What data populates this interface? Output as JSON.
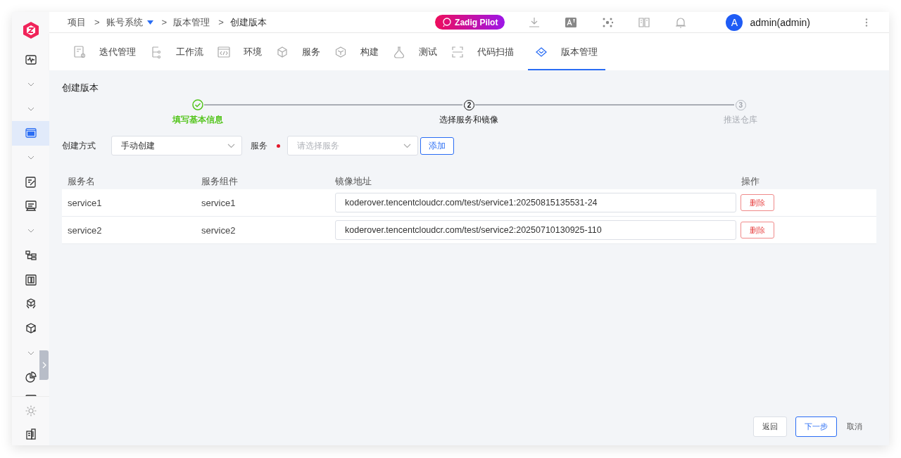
{
  "sidebar": {
    "items": [
      {
        "kind": "icon",
        "selected": false
      },
      {
        "kind": "chevron",
        "selected": false
      },
      {
        "kind": "chevron",
        "selected": false
      },
      {
        "kind": "icon",
        "selected": true
      },
      {
        "kind": "chevron",
        "selected": false
      },
      {
        "kind": "icon",
        "selected": false
      },
      {
        "kind": "icon",
        "selected": false
      },
      {
        "kind": "chevron",
        "selected": false
      },
      {
        "kind": "icon",
        "selected": false
      },
      {
        "kind": "icon",
        "selected": false
      },
      {
        "kind": "icon",
        "selected": false
      },
      {
        "kind": "icon",
        "selected": false
      },
      {
        "kind": "chevron",
        "selected": false
      },
      {
        "kind": "icon",
        "selected": false
      },
      {
        "kind": "icon",
        "selected": false
      }
    ],
    "bottom_items": [
      {
        "kind": "icon",
        "selected": false
      },
      {
        "kind": "icon",
        "selected": false
      }
    ]
  },
  "breadcrumb": {
    "separator": ">",
    "items": [
      {
        "text": "项目",
        "dropdown": false,
        "current": false
      },
      {
        "text": "账号系统",
        "dropdown": true,
        "current": false
      },
      {
        "text": "版本管理",
        "dropdown": false,
        "current": false
      },
      {
        "text": "创建版本",
        "dropdown": false,
        "current": true
      }
    ]
  },
  "topbar": {
    "pilot_button": "Zadig Pilot",
    "avatar_letter": "A",
    "user": "admin(admin)"
  },
  "tabs": [
    {
      "label": "迭代管理",
      "selected": false
    },
    {
      "label": "工作流",
      "selected": false
    },
    {
      "label": "环境",
      "selected": false
    },
    {
      "label": "服务",
      "selected": false
    },
    {
      "label": "构建",
      "selected": false
    },
    {
      "label": "测试",
      "selected": false
    },
    {
      "label": "代码扫描",
      "selected": false
    },
    {
      "label": "版本管理",
      "selected": true
    }
  ],
  "page_title": "创建版本",
  "steps": [
    {
      "kind": "done",
      "label": "填写基本信息"
    },
    {
      "kind": "current",
      "number": "2",
      "label": "选择服务和镜像"
    },
    {
      "kind": "pending",
      "number": "3",
      "label": "推送仓库"
    }
  ],
  "form": {
    "create_method": {
      "label": "创建方式",
      "value": "手动创建"
    },
    "service": {
      "label": "服务",
      "required": true,
      "placeholder": "请选择服务"
    },
    "add_button": "添加"
  },
  "table": {
    "columns": [
      "服务名",
      "服务组件",
      "镜像地址",
      "操作"
    ],
    "rows": [
      {
        "name": "service1",
        "component": "service1",
        "image": "koderover.tencentcloudcr.com/test/service1:20250815135531-24",
        "action": "删除"
      },
      {
        "name": "service2",
        "component": "service2",
        "image": "koderover.tencentcloudcr.com/test/service2:20250710130925-110",
        "action": "删除"
      }
    ]
  },
  "footer_buttons": [
    {
      "label": "返回",
      "kind": "default"
    },
    {
      "label": "下一步",
      "kind": "primary"
    },
    {
      "label": "取消",
      "kind": "text"
    }
  ]
}
